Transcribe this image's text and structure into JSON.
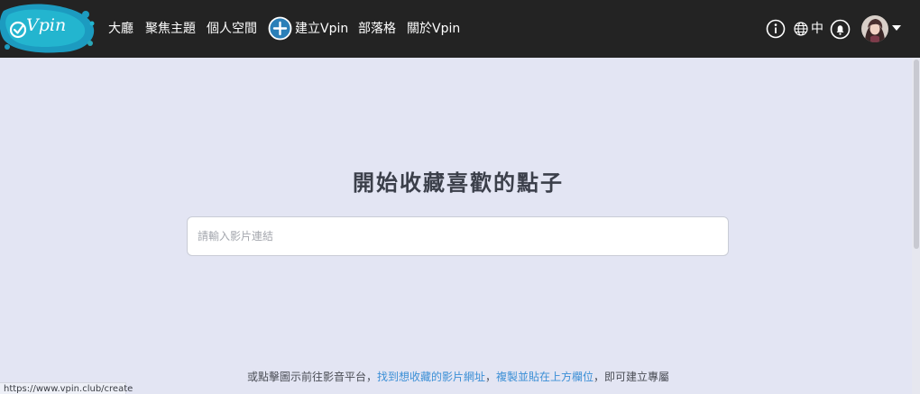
{
  "app": {
    "logo_text": "Vpin"
  },
  "nav": {
    "items": [
      {
        "label": "大廳"
      },
      {
        "label": "聚焦主題"
      },
      {
        "label": "個人空間"
      },
      {
        "label": "建立Vpin"
      },
      {
        "label": "部落格"
      },
      {
        "label": "關於Vpin"
      }
    ],
    "language": "中",
    "icons": [
      "info-icon",
      "globe-icon",
      "bell-icon",
      "avatar",
      "chevron-down-icon"
    ]
  },
  "main": {
    "headline": "開始收藏喜歡的點子",
    "input": {
      "placeholder": "請輸入影片連結",
      "value": ""
    },
    "hint": {
      "prefix": "或點擊圖示前往影音平台，",
      "link1": "找到想收藏的影片網址",
      "sep": "，",
      "link2": "複製並貼在上方欄位",
      "suffix": "，即可建立專屬"
    }
  },
  "status_bar": {
    "url": "https://www.vpin.club/create"
  },
  "colors": {
    "navbar_bg": "#232323",
    "page_bg": "#e3e5f3",
    "link": "#3b8fd6",
    "logo_splash": "#1fa5c4"
  }
}
